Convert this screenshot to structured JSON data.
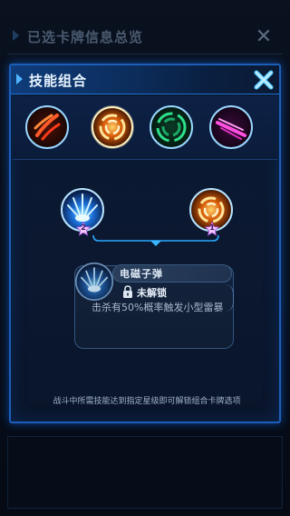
{
  "background": {
    "title": "已选卡牌信息总览",
    "close_icon": "close-icon"
  },
  "modal": {
    "title": "技能组合",
    "close_icon": "close-x-icon"
  },
  "skills": [
    {
      "name": "claw-slash-skill-icon",
      "color": "#ff4a2a"
    },
    {
      "name": "fire-vortex-skill-icon",
      "color": "#ff9a1f",
      "selected": true
    },
    {
      "name": "green-swirl-skill-icon",
      "color": "#22d07a"
    },
    {
      "name": "pink-slash-skill-icon",
      "color": "#ff3bd6"
    }
  ],
  "combo": {
    "left": {
      "icon": "electro-bullet-skill-icon",
      "star": "2"
    },
    "right": {
      "icon": "fire-vortex-skill-icon",
      "star": "1"
    }
  },
  "detail": {
    "icon": "electro-bullet-skill-icon",
    "name": "电磁子弹",
    "lock_label": "未解锁",
    "description": "击杀有50%概率触发小型雷暴"
  },
  "hint": "战斗中所需技能达到指定星级即可解锁组合卡牌选项"
}
